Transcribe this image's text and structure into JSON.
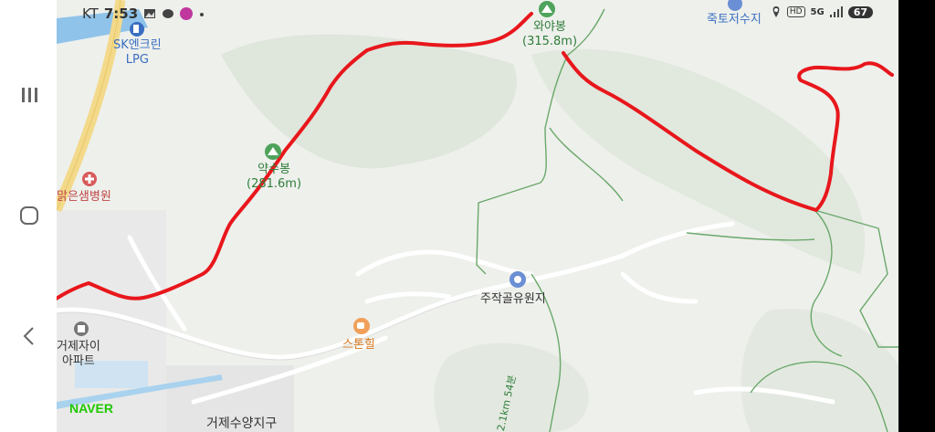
{
  "status_bar": {
    "carrier": "KT",
    "time": "7:53",
    "battery": "67",
    "network": "5G",
    "hd_label": "HD"
  },
  "map": {
    "brand": "NAVER",
    "peaks": [
      {
        "name": "와야봉",
        "elevation": "(315.8m)"
      },
      {
        "name": "약수봉",
        "elevation": "(281.6m)"
      }
    ],
    "pois": {
      "gas_station": "SK엔크린\nLPG",
      "hospital": "맑은샘병원",
      "apartment": "거제자이\n아파트",
      "cafe": "스톤힐",
      "park": "주작골유원지",
      "reservoir": "죽토저수지",
      "district": "거제수양지구"
    },
    "trail_distance": "2.1km 54분",
    "colors": {
      "route": "#e8171c",
      "forest": "#dfe6dc",
      "road": "#ffffff",
      "highway": "#f3d98a",
      "trail": "#6aa86a",
      "water": "#8fc3ea"
    }
  }
}
